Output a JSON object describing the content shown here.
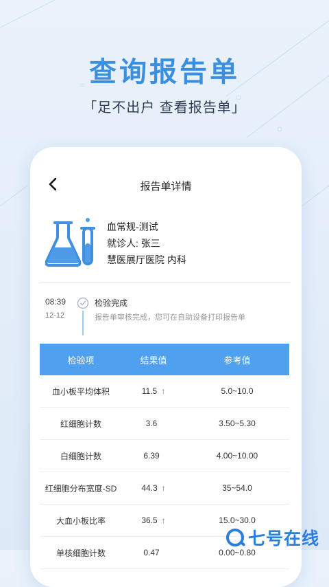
{
  "header": {
    "title": "查询报告单",
    "subtitle": "「足不出户 查看报告单」"
  },
  "navbar": {
    "title": "报告单详情"
  },
  "report": {
    "name": "血常规-测试",
    "patient": "就诊人: 张三",
    "hospital": "慧医展厅医院 内科"
  },
  "timeline": {
    "time": "08:39",
    "date": "12-12",
    "status": "检验完成",
    "note": "报告单审核完成，您可在自助设备打印报告单"
  },
  "table": {
    "headers": [
      "检验项",
      "结果值",
      "参考值"
    ],
    "rows": [
      {
        "item": "血小板平均体积",
        "value": "11.5",
        "flag": "↑",
        "ref": "5.0~10.0"
      },
      {
        "item": "红细胞计数",
        "value": "3.6",
        "flag": "",
        "ref": "3.50~5.30"
      },
      {
        "item": "白细胞计数",
        "value": "6.39",
        "flag": "",
        "ref": "4.00~10.00"
      },
      {
        "item": "红细胞分布宽度-SD",
        "value": "44.3",
        "flag": "↑",
        "ref": "35~54.0"
      },
      {
        "item": "大血小板比率",
        "value": "36.5",
        "flag": "↑",
        "ref": "15.0~30.0"
      },
      {
        "item": "单核细胞计数",
        "value": "0.47",
        "flag": "",
        "ref": "0.00~0.80"
      }
    ]
  },
  "watermark": {
    "text": "七号在线"
  },
  "colors": {
    "accent": "#3a8fe0",
    "table_header": "#4fa0ee"
  }
}
